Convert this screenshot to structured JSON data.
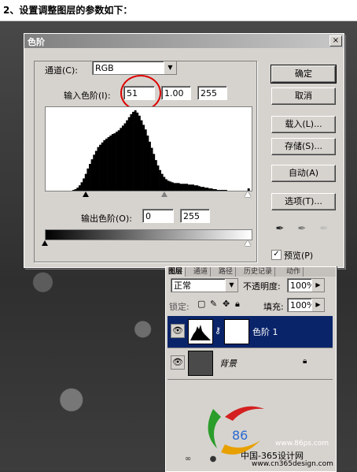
{
  "caption": "2、设置调整图层的参数如下：",
  "dialog": {
    "title": "色阶",
    "close": "×",
    "channel_label": "通道(C):",
    "channel_value": "RGB",
    "input_label": "输入色阶(I):",
    "input_black": "51",
    "input_gamma": "1.00",
    "input_white": "255",
    "output_label": "输出色阶(O):",
    "output_black": "0",
    "output_white": "255",
    "buttons": {
      "ok": "确定",
      "cancel": "取消",
      "load": "载入(L)...",
      "save": "存储(S)...",
      "auto": "自动(A)",
      "options": "选项(T)..."
    },
    "preview_label": "预览(P)",
    "preview_checked": true,
    "accent_annotation_color": "#dd0000"
  },
  "histogram": [
    0,
    0,
    0,
    0,
    0,
    0,
    0,
    0,
    0,
    0,
    0,
    0,
    0,
    1,
    2,
    4,
    7,
    11,
    16,
    22,
    29,
    35,
    41,
    47,
    52,
    57,
    60,
    63,
    66,
    68,
    70,
    72,
    74,
    75,
    77,
    79,
    82,
    85,
    88,
    92,
    96,
    100,
    103,
    105,
    102,
    98,
    92,
    86,
    80,
    72,
    64,
    56,
    48,
    40,
    33,
    27,
    22,
    18,
    15,
    13,
    12,
    11,
    10,
    10,
    10,
    9,
    9,
    9,
    9,
    8,
    8,
    8,
    7,
    7,
    6,
    5,
    5,
    4,
    4,
    3,
    3,
    2,
    2,
    1,
    1,
    1,
    1,
    1,
    0,
    0,
    0,
    0,
    0,
    0,
    0,
    0,
    0,
    0,
    3,
    0
  ],
  "layers": {
    "tabs": [
      "图层",
      "通道",
      "路径",
      "历史记录",
      "动作"
    ],
    "blend_mode": "正常",
    "opacity_label": "不透明度:",
    "opacity_value": "100%",
    "lock_label": "锁定:",
    "fill_label": "填充:",
    "fill_value": "100%",
    "rows": [
      {
        "name": "色阶 1",
        "selected": true
      },
      {
        "name": "背景",
        "selected": false
      }
    ]
  },
  "watermark": {
    "brand": "中国-365设计网",
    "url": "www.cn365design.com",
    "small": "www.86ps.com",
    "logo_text": "86"
  }
}
